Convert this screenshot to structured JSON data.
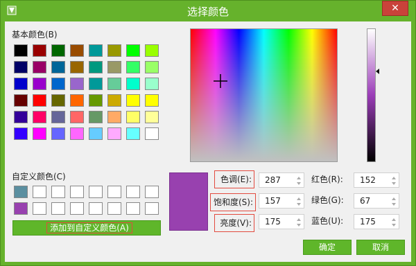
{
  "window": {
    "title": "选择颜色",
    "close_glyph": "✕",
    "icon": "app-icon"
  },
  "basic_colors": {
    "label": "基本颜色(B)",
    "rows": [
      [
        "#000000",
        "#990000",
        "#006600",
        "#994c00",
        "#009999",
        "#999900",
        "#00ff00",
        "#99ff00"
      ],
      [
        "#000066",
        "#990066",
        "#006699",
        "#996600",
        "#00997f",
        "#999966",
        "#33ff66",
        "#99ff66"
      ],
      [
        "#0000cc",
        "#9900cc",
        "#0066cc",
        "#9966cc",
        "#009999",
        "#66cc99",
        "#00ffcc",
        "#99ffcc"
      ],
      [
        "#660000",
        "#ff0000",
        "#666600",
        "#ff6600",
        "#669900",
        "#ccaa00",
        "#ffff00",
        "#ffff00"
      ],
      [
        "#330099",
        "#ff0066",
        "#666699",
        "#ff6666",
        "#669966",
        "#ffaa66",
        "#ffff66",
        "#ffff99"
      ],
      [
        "#3300ff",
        "#ff00ff",
        "#6666ff",
        "#ff66ff",
        "#66ccff",
        "#ffaaff",
        "#66ffff",
        "#ffffff"
      ]
    ]
  },
  "custom_colors": {
    "label": "自定义颜色(C)",
    "rows": [
      [
        "#5b8fa0",
        "#ffffff",
        "#ffffff",
        "#ffffff",
        "#ffffff",
        "#ffffff",
        "#ffffff",
        "#ffffff"
      ],
      [
        "#9841af",
        "#ffffff",
        "#ffffff",
        "#ffffff",
        "#ffffff",
        "#ffffff",
        "#ffffff",
        "#ffffff"
      ]
    ],
    "add_button": "添加到自定义颜色(A)"
  },
  "preview_color": "#9841af",
  "hsl": {
    "hue": {
      "label": "色调(E):",
      "value": "287"
    },
    "sat": {
      "label": "饱和度(S):",
      "value": "157"
    },
    "lum": {
      "label": "亮度(V):",
      "value": "175"
    }
  },
  "rgb": {
    "red": {
      "label": "红色(R):",
      "value": "152"
    },
    "green": {
      "label": "绿色(G):",
      "value": "67"
    },
    "blue": {
      "label": "蓝色(U):",
      "value": "175"
    }
  },
  "buttons": {
    "ok": "确定",
    "cancel": "取消"
  }
}
